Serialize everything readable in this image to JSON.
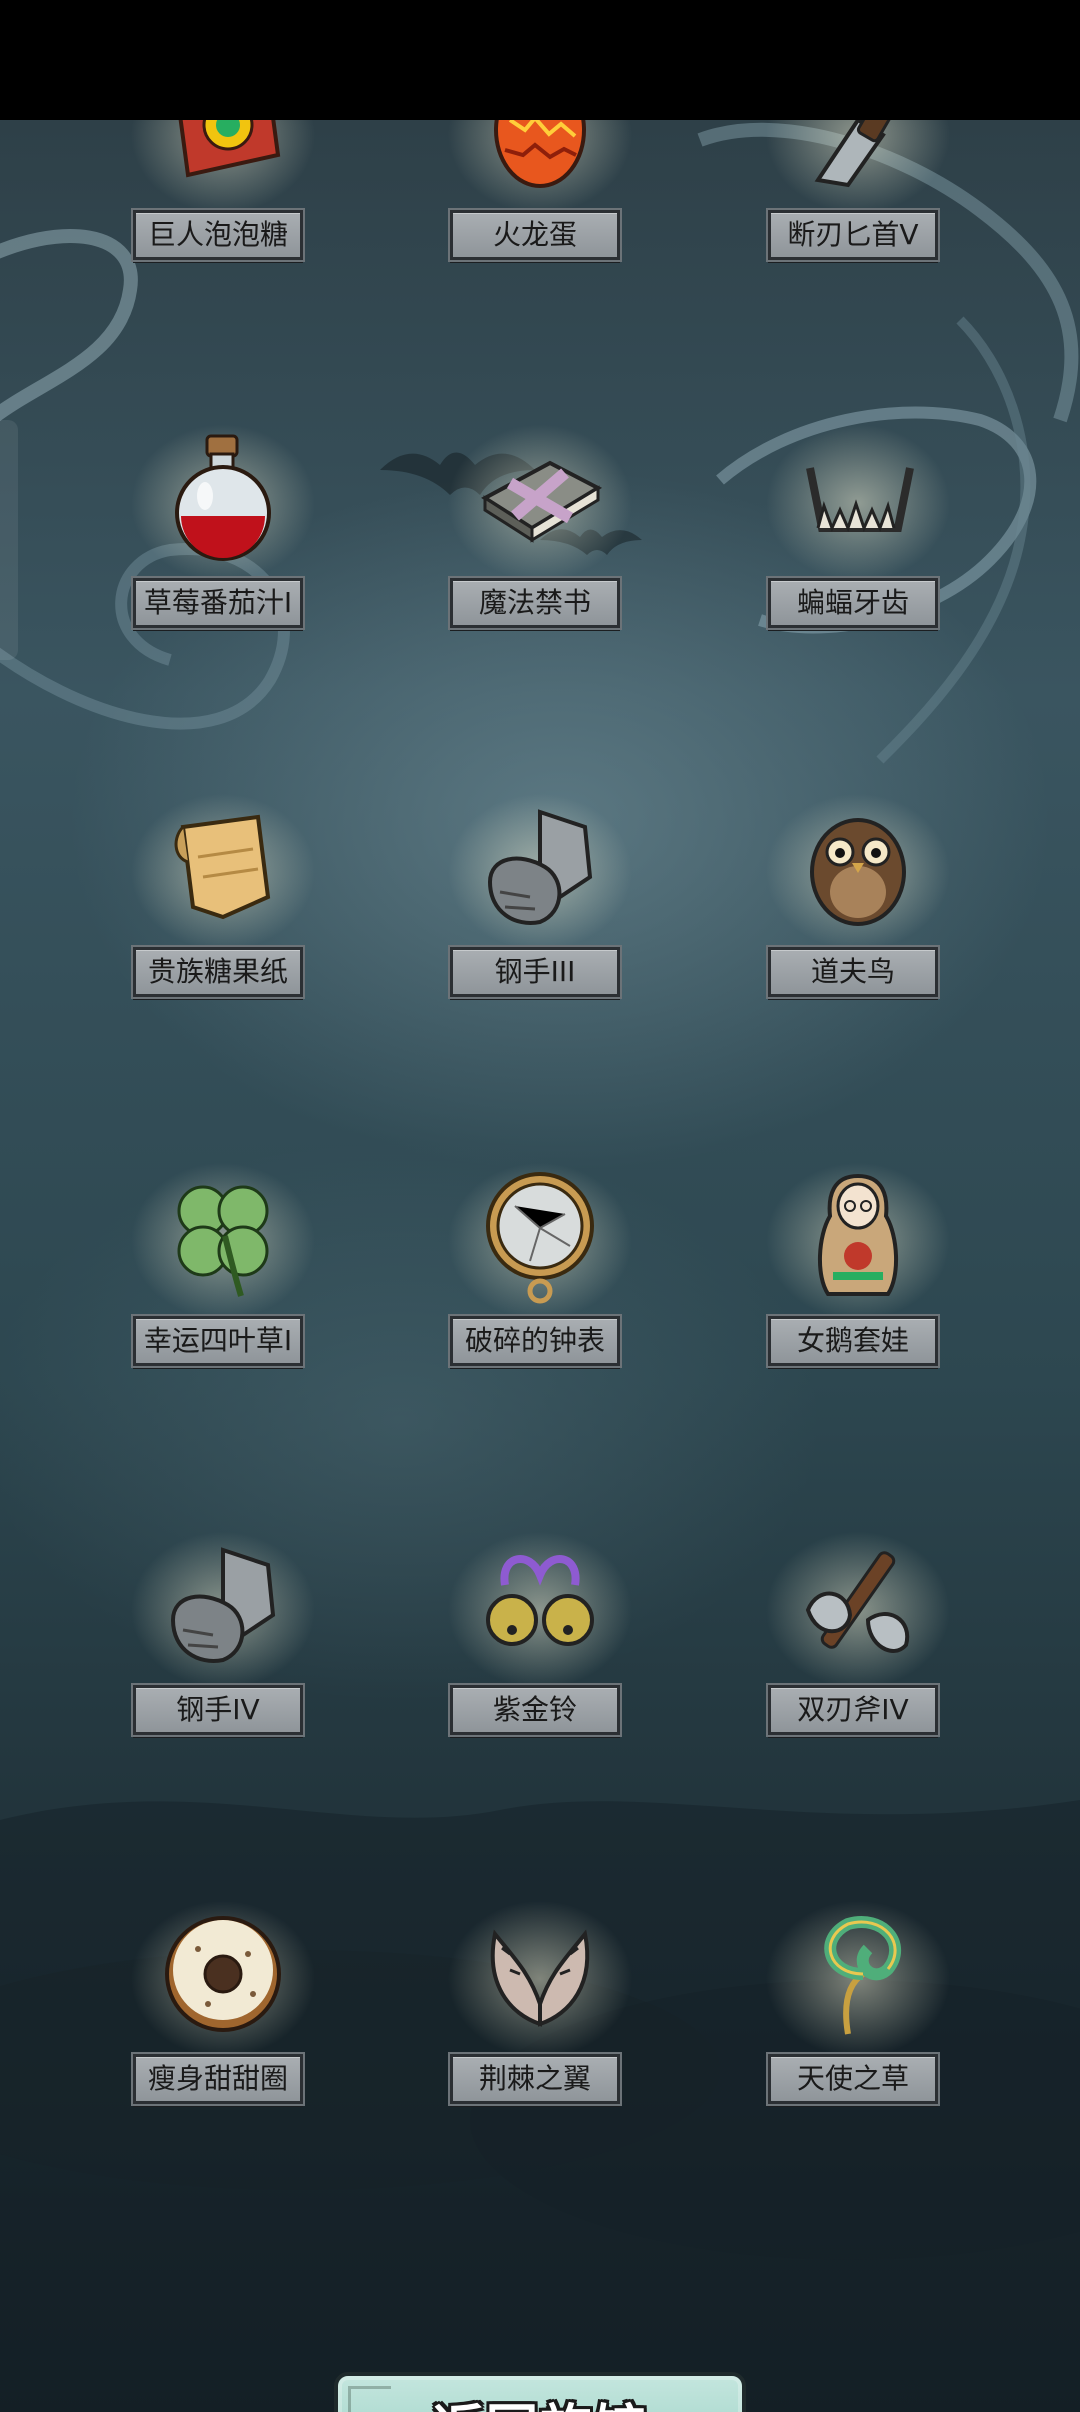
{
  "items": [
    {
      "name": "巨人泡泡糖",
      "icon": "giant-bubblegum-icon"
    },
    {
      "name": "火龙蛋",
      "icon": "fire-dragon-egg-icon"
    },
    {
      "name": "断刃匕首V",
      "icon": "broken-dagger-icon"
    },
    {
      "name": "草莓番茄汁I",
      "icon": "red-potion-icon"
    },
    {
      "name": "魔法禁书",
      "icon": "forbidden-book-icon"
    },
    {
      "name": "蝙蝠牙齿",
      "icon": "bat-teeth-icon"
    },
    {
      "name": "贵族糖果纸",
      "icon": "candy-wrapper-icon"
    },
    {
      "name": "钢手III",
      "icon": "steel-gauntlet-icon"
    },
    {
      "name": "道夫鸟",
      "icon": "owl-icon"
    },
    {
      "name": "幸运四叶草I",
      "icon": "four-leaf-clover-icon"
    },
    {
      "name": "破碎的钟表",
      "icon": "broken-pocket-watch-icon"
    },
    {
      "name": "女鹅套娃",
      "icon": "nesting-doll-icon"
    },
    {
      "name": "钢手IV",
      "icon": "steel-gauntlet-icon"
    },
    {
      "name": "紫金铃",
      "icon": "purple-gold-bells-icon"
    },
    {
      "name": "双刃斧IV",
      "icon": "double-axe-icon"
    },
    {
      "name": "瘦身甜甜圈",
      "icon": "donut-icon"
    },
    {
      "name": "荆棘之翼",
      "icon": "thorn-wings-icon"
    },
    {
      "name": "天使之草",
      "icon": "angel-grass-icon"
    }
  ],
  "return_button": {
    "label": "返回旅馆"
  },
  "colors": {
    "label_bg": "#9aa0a4",
    "label_border": "#2b2f33",
    "button_bg": "#b5ddd3",
    "background": "#2e4048"
  }
}
